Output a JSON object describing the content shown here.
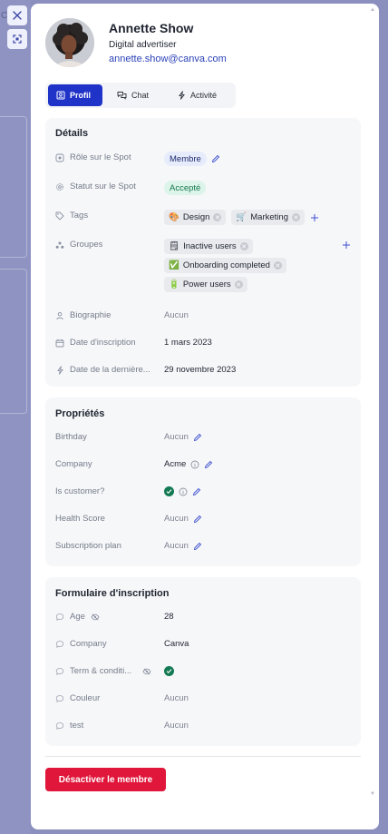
{
  "background": {
    "fragment_text": "C"
  },
  "controls": {
    "close_label": "Fermer",
    "expand_label": "Agrandir"
  },
  "profile": {
    "name": "Annette Show",
    "job": "Digital advertiser",
    "email": "annette.show@canva.com"
  },
  "tabs": [
    {
      "label": "Profil",
      "active": true,
      "icon": "user-card-icon"
    },
    {
      "label": "Chat",
      "active": false,
      "icon": "chat-bubbles-icon"
    },
    {
      "label": "Activité",
      "active": false,
      "icon": "lightning-icon"
    }
  ],
  "details": {
    "title": "Détails",
    "role_label": "Rôle sur le Spot",
    "role_value": "Membre",
    "status_label": "Statut sur le Spot",
    "status_value": "Accepté",
    "tags_label": "Tags",
    "tags": [
      {
        "emoji": "🎨",
        "label": "Design"
      },
      {
        "emoji": "🛒",
        "label": "Marketing"
      }
    ],
    "groups_label": "Groupes",
    "groups": [
      {
        "emoji": "🗒",
        "label": "Inactive users"
      },
      {
        "emoji": "✅",
        "label": "Onboarding completed"
      },
      {
        "emoji": "🔋",
        "label": "Power users"
      }
    ],
    "bio_label": "Biographie",
    "bio_value": "Aucun",
    "signup_label": "Date d'inscription",
    "signup_value": "1 mars 2023",
    "last_label": "Date de la dernière...",
    "last_value": "29 novembre 2023"
  },
  "properties": {
    "title": "Propriétés",
    "birthday_label": "Birthday",
    "birthday_value": "Aucun",
    "company_label": "Company",
    "company_value": "Acme",
    "customer_label": "Is customer?",
    "health_label": "Health Score",
    "health_value": "Aucun",
    "plan_label": "Subscription plan",
    "plan_value": "Aucun"
  },
  "form": {
    "title": "Formulaire d'inscription",
    "age_label": "Age",
    "age_value": "28",
    "company_label": "Company",
    "company_value": "Canva",
    "terms_label": "Term & conditi...",
    "color_label": "Couleur",
    "color_value": "Aucun",
    "test_label": "test",
    "test_value": "Aucun"
  },
  "actions": {
    "deactivate_label": "Désactiver le membre"
  },
  "colors": {
    "accent": "#1f33c8",
    "link": "#2c43b8",
    "danger": "#e0163a",
    "success": "#137a54",
    "overlay": "#8a8fbe"
  }
}
